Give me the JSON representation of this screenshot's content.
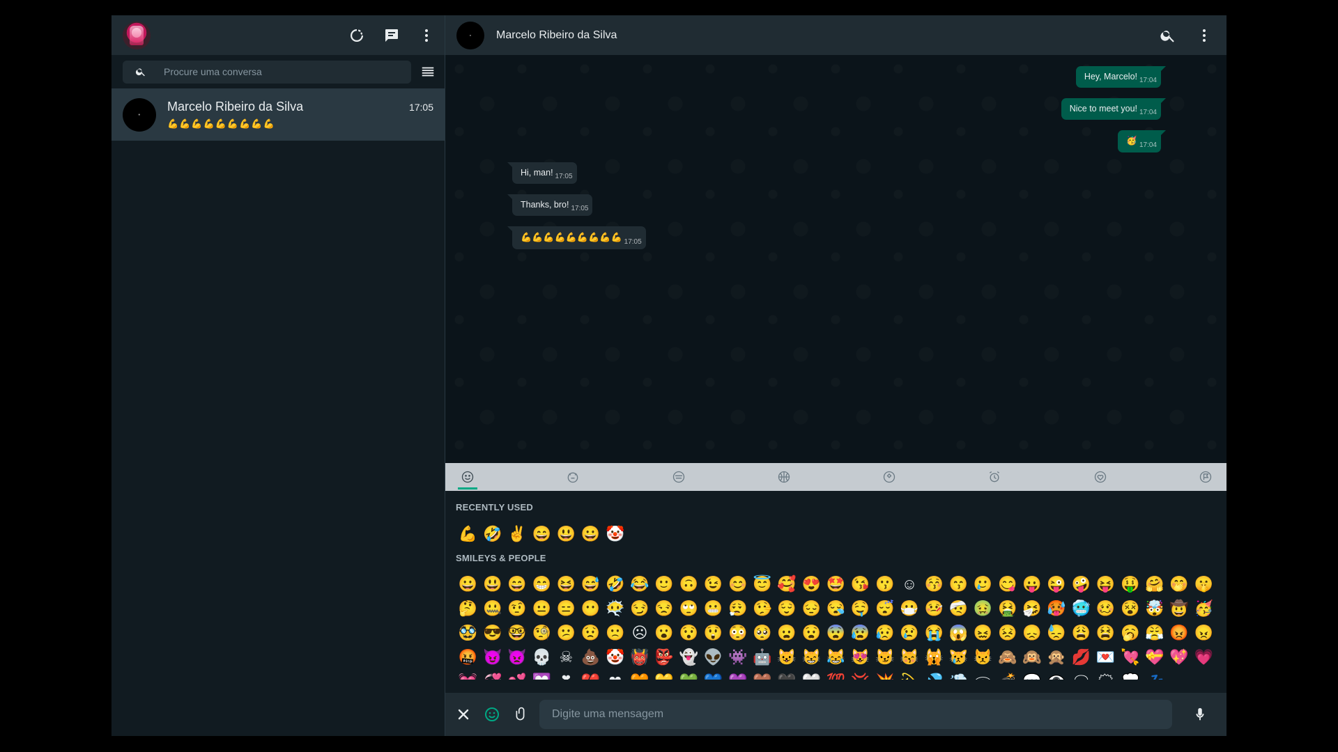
{
  "sidebar": {
    "search_placeholder": "Procure uma conversa",
    "chats": [
      {
        "name": "Marcelo Ribeiro da Silva",
        "time": "17:05",
        "preview": "💪💪💪💪💪💪💪💪💪"
      }
    ]
  },
  "chat": {
    "contact_name": "Marcelo Ribeiro da Silva",
    "messages": [
      {
        "dir": "out",
        "text": "Hey, Marcelo!",
        "time": "17:04"
      },
      {
        "dir": "out",
        "text": "Nice to meet you!",
        "time": "17:04"
      },
      {
        "dir": "out",
        "text": "🥳",
        "time": "17:04"
      },
      {
        "dir": "in",
        "text": "Hi, man!",
        "time": "17:05"
      },
      {
        "dir": "in",
        "text": "Thanks, bro!",
        "time": "17:05"
      },
      {
        "dir": "in",
        "text": "💪💪💪💪💪💪💪💪💪",
        "time": "17:05"
      }
    ]
  },
  "emoji_panel": {
    "recent_title": "RECENTLY USED",
    "recent": "💪🤣✌😄😃😀🤡",
    "smileys_title": "SMILEYS & PEOPLE",
    "smileys": "😀😃😄😁😆😅🤣😂🙂🙃😉😊😇🥰😍🤩😘😗☺😚😙🥲😋😛😜🤪😝🤑🤗🤭🤫🤔🤐🤨😐😑😶😶‍🌫️😏😒🙄😬😮‍💨🤥😌😔😪🤤😴😷🤒🤕🤢🤮🤧🥵🥶🥴😵🤯🤠🥳🥸😎🤓🧐😕😟🙁☹😮😯😲😳🥺😦😧😨😰😥😢😭😱😖😣😞😓😩😫🥱😤😡😠🤬😈👿💀☠💩🤡👹👺👻👽👾🤖😺😸😹😻😼😽🙀😿😾🙈🙉🙊💋💌💘💝💖💗💓💞💕💟❣💔❤🧡💛💚💙💜🤎🖤🤍💯💢💥💫💦💨🕳💣💬👁‍🗨🗨🗯💭💤"
  },
  "composer": {
    "placeholder": "Digite uma mensagem"
  },
  "colors": {
    "accent": "#00a884",
    "outgoing_bubble": "#005c4b",
    "incoming_bubble": "#202c33",
    "header": "#202c33",
    "background": "#0b141a"
  }
}
